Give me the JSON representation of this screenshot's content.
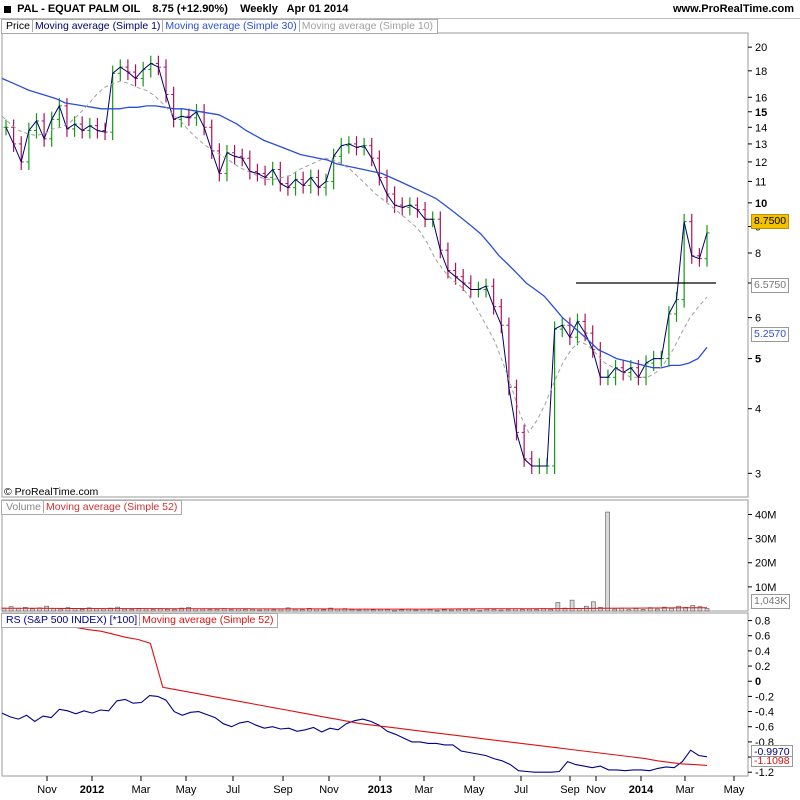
{
  "header": {
    "symbol": "PAL - EQUAT PALM OIL",
    "last": "8.75 (+12.90%)",
    "period": "Weekly",
    "date": "Apr 01 2014",
    "site": "www.ProRealTime.com"
  },
  "copyright": "© ProRealTime.com",
  "panels": {
    "price_legend": {
      "price": "Price",
      "ma1": "Moving average (Simple 1)",
      "ma30": "Moving average (Simple 30)",
      "ma10": "Moving average (Simple 10)"
    },
    "volume_legend": {
      "volume": "Volume",
      "ma52": "Moving average (Simple 52)"
    },
    "rs_legend": {
      "rs": "RS (S&P 500 INDEX) [*100]",
      "ma52": "Moving average (Simple 52)"
    }
  },
  "tags": {
    "price": "8.7500",
    "ma10": "6.5750",
    "ma30": "5.2570",
    "volume": "1,043K",
    "rs": "-0.9970",
    "rs_ma": "-1.1098"
  },
  "colors": {
    "up": "#159a15",
    "down": "#b0105a",
    "ma1": "#00006e",
    "ma30": "#2a4fd6",
    "ma10": "#a0a0a0",
    "rs": "#00008b",
    "rs_ma": "#e01010",
    "level": "#000000",
    "volume": "#a0a0a0"
  },
  "chart_data": [
    {
      "type": "line",
      "title": "PAL - EQUAT PALM OIL",
      "scale": "log",
      "yticks": [
        3,
        4,
        5,
        6,
        7,
        8,
        9,
        10,
        11,
        12,
        13,
        14,
        15,
        16,
        18,
        20
      ],
      "x_tick_labels": [
        "Nov",
        "2012",
        "Mar",
        "May",
        "Jul",
        "Sep",
        "Nov",
        "2013",
        "Mar",
        "May",
        "Jul",
        "Sep",
        "Nov",
        "2014",
        "Mar",
        "May"
      ],
      "horizontal_level": 7.0,
      "series": [
        {
          "name": "Price",
          "values": [
            14.0,
            13.0,
            12.0,
            13.8,
            14.4,
            13.3,
            14.5,
            15.4,
            13.9,
            14.2,
            13.8,
            14.1,
            13.8,
            13.7,
            17.8,
            18.3,
            17.9,
            17.4,
            18.1,
            18.6,
            18.3,
            16.2,
            14.5,
            14.7,
            14.6,
            15.0,
            14.0,
            12.6,
            11.4,
            12.5,
            12.3,
            12.2,
            11.5,
            11.4,
            11.2,
            11.6,
            10.9,
            10.7,
            11.1,
            10.8,
            11.2,
            10.7,
            11.0,
            12.3,
            12.9,
            13.0,
            12.8,
            12.9,
            12.2,
            11.2,
            10.4,
            9.9,
            9.8,
            9.9,
            9.7,
            9.3,
            9.3,
            8.1,
            7.4,
            7.2,
            7.0,
            6.8,
            6.8,
            6.9,
            6.3,
            5.8,
            4.4,
            3.6,
            3.2,
            3.1,
            3.1,
            3.1,
            5.7,
            5.8,
            5.5,
            5.9,
            5.6,
            5.2,
            4.6,
            4.6,
            4.8,
            4.7,
            4.8,
            4.6,
            4.9,
            5.0,
            5.0,
            6.1,
            6.5,
            9.2,
            7.9,
            7.8,
            8.75
          ]
        },
        {
          "name": "Moving average (Simple 30)",
          "values": [
            17.4,
            17.1,
            16.8,
            16.5,
            16.3,
            16.1,
            15.9,
            15.6,
            15.5,
            15.4,
            15.3,
            15.2,
            15.2,
            15.2,
            15.3,
            15.3,
            15.4,
            15.4,
            15.3,
            15.2,
            15.2,
            15.1,
            15.0,
            14.9,
            14.8,
            14.5,
            14.2,
            13.8,
            13.5,
            13.2,
            13.0,
            12.8,
            12.6,
            12.4,
            12.3,
            12.2,
            12.1,
            11.9,
            11.8,
            11.7,
            11.6,
            11.5,
            11.4,
            11.2,
            11.0,
            10.8,
            10.6,
            10.4,
            10.2,
            9.9,
            9.6,
            9.3,
            9.0,
            8.7,
            8.3,
            7.9,
            7.6,
            7.3,
            7.0,
            6.8,
            6.6,
            6.3,
            6.0,
            5.8,
            5.6,
            5.4,
            5.2,
            5.1,
            5.0,
            4.95,
            4.9,
            4.85,
            4.8,
            4.8,
            4.85,
            4.85,
            4.9,
            5.0,
            5.257
          ]
        },
        {
          "name": "Moving average (Simple 10)",
          "values": [
            14.7,
            14.2,
            13.8,
            13.6,
            13.5,
            13.6,
            13.9,
            14.0,
            14.3,
            14.8,
            15.4,
            16.1,
            16.7,
            17.0,
            17.2,
            17.0,
            16.7,
            16.5,
            16.1,
            15.5,
            14.9,
            14.4,
            13.8,
            13.3,
            12.9,
            12.6,
            12.3,
            12.0,
            11.7,
            11.5,
            11.3,
            11.1,
            11.1,
            11.2,
            11.3,
            11.6,
            11.8,
            12.0,
            12.2,
            12.1,
            11.9,
            11.6,
            11.2,
            10.8,
            10.4,
            10.1,
            9.8,
            9.5,
            9.2,
            8.9,
            8.4,
            7.8,
            7.4,
            7.1,
            6.9,
            6.6,
            6.2,
            5.8,
            5.4,
            4.9,
            4.4,
            3.9,
            3.6,
            3.8,
            4.1,
            4.5,
            4.9,
            5.2,
            5.4,
            5.3,
            5.1,
            4.9,
            4.8,
            4.7,
            4.6,
            4.6,
            4.6,
            4.7,
            4.9,
            5.2,
            5.6,
            6.0,
            6.3,
            6.575
          ]
        }
      ]
    },
    {
      "type": "bar",
      "title": "Volume",
      "yticks": [
        "10M",
        "20M",
        "30M",
        "40M"
      ],
      "y_unit": "M",
      "series": [
        {
          "name": "Volume",
          "values": [
            1.2,
            1.8,
            1.1,
            1.5,
            0.9,
            1.3,
            2.0,
            1.1,
            0.8,
            1.4,
            0.9,
            0.7,
            1.3,
            1.0,
            0.9,
            1.2,
            1.6,
            0.8,
            0.7,
            1.1,
            0.9,
            0.6,
            1.0,
            0.7,
            0.5,
            1.2,
            1.5,
            0.9,
            0.8,
            0.6,
            0.7,
            1.0,
            0.5,
            0.9,
            0.6,
            0.7,
            0.4,
            0.8,
            0.5,
            0.9,
            1.3,
            0.7,
            0.6,
            1.1,
            0.8,
            0.5,
            1.2,
            0.9,
            1.0,
            0.6,
            0.4,
            0.8,
            0.5,
            0.7,
            0.6,
            0.3,
            0.5,
            0.8,
            0.4,
            0.7,
            0.6,
            0.3,
            0.5,
            0.4,
            0.7,
            0.6,
            0.5,
            0.3,
            0.7,
            0.6,
            0.4,
            0.5,
            0.9,
            0.6,
            0.8,
            0.5,
            1.0,
            0.7,
            3.5,
            1.2,
            4.5,
            1.0,
            2.0,
            3.8,
            1.5,
            41.0,
            0.8,
            1.2,
            0.6,
            1.0,
            0.7,
            1.4,
            0.8,
            1.6,
            1.1,
            2.0,
            1.5,
            2.3,
            1.8,
            1.043
          ]
        },
        {
          "name": "Moving average (Simple 52)",
          "values": [
            1.1,
            1.1,
            1.05,
            1.0,
            1.0,
            0.95,
            0.9,
            0.9,
            0.85,
            0.85,
            0.8,
            0.8,
            0.8,
            0.85,
            0.9,
            0.9,
            1.0,
            1.1,
            1.2,
            1.3,
            1.35
          ]
        }
      ]
    },
    {
      "type": "line",
      "title": "RS (S&P 500 INDEX) [*100]",
      "yticks": [
        -1.2,
        -1.0,
        -0.8,
        -0.6,
        -0.4,
        -0.2,
        0,
        0.2,
        0.4,
        0.6,
        0.8
      ],
      "series": [
        {
          "name": "RS (S&P 500 INDEX) [*100]",
          "values": [
            -0.42,
            -0.47,
            -0.5,
            -0.45,
            -0.53,
            -0.46,
            -0.48,
            -0.37,
            -0.39,
            -0.43,
            -0.39,
            -0.42,
            -0.38,
            -0.39,
            -0.26,
            -0.24,
            -0.29,
            -0.28,
            -0.19,
            -0.2,
            -0.25,
            -0.4,
            -0.45,
            -0.41,
            -0.4,
            -0.44,
            -0.48,
            -0.56,
            -0.6,
            -0.55,
            -0.53,
            -0.58,
            -0.62,
            -0.6,
            -0.63,
            -0.62,
            -0.66,
            -0.64,
            -0.61,
            -0.67,
            -0.62,
            -0.64,
            -0.56,
            -0.52,
            -0.5,
            -0.53,
            -0.58,
            -0.66,
            -0.7,
            -0.75,
            -0.8,
            -0.8,
            -0.82,
            -0.82,
            -0.84,
            -0.84,
            -0.92,
            -0.94,
            -0.96,
            -0.98,
            -1.02,
            -1.05,
            -1.1,
            -1.18,
            -1.19,
            -1.2,
            -1.2,
            -1.2,
            -1.19,
            -1.06,
            -1.1,
            -1.12,
            -1.14,
            -1.12,
            -1.17,
            -1.17,
            -1.18,
            -1.17,
            -1.17,
            -1.18,
            -1.15,
            -1.13,
            -1.14,
            -1.06,
            -0.91,
            -0.98,
            -0.997
          ]
        },
        {
          "name": "Moving average (Simple 52)",
          "values": [
            0.83,
            0.81,
            0.79,
            0.77,
            0.75,
            0.73,
            0.71,
            0.68,
            0.66,
            0.62,
            0.58,
            0.55,
            0.5,
            -0.08,
            -0.11,
            -0.14,
            -0.17,
            -0.2,
            -0.23,
            -0.26,
            -0.29,
            -0.32,
            -0.35,
            -0.38,
            -0.41,
            -0.44,
            -0.47,
            -0.5,
            -0.53,
            -0.56,
            -0.58,
            -0.6,
            -0.62,
            -0.64,
            -0.66,
            -0.68,
            -0.7,
            -0.72,
            -0.74,
            -0.76,
            -0.78,
            -0.8,
            -0.82,
            -0.84,
            -0.86,
            -0.88,
            -0.9,
            -0.92,
            -0.94,
            -0.96,
            -0.98,
            -1.0,
            -1.02,
            -1.05,
            -1.07,
            -1.09,
            -1.1,
            -1.1098
          ]
        }
      ]
    }
  ]
}
